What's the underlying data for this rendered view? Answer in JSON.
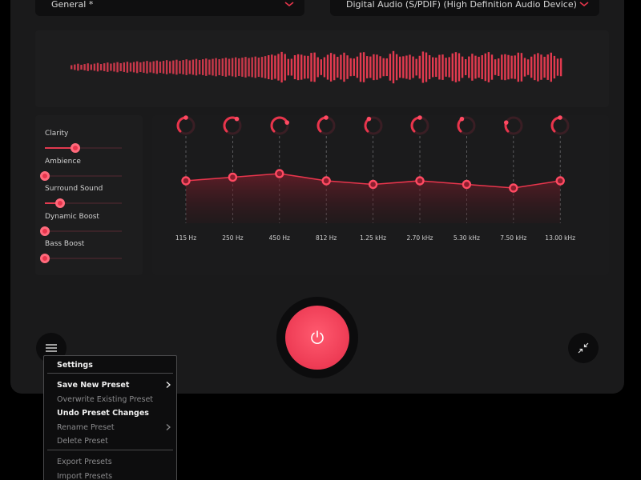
{
  "header": {
    "preset_dropdown": {
      "value": "General *"
    },
    "device_dropdown": {
      "value": "Digital Audio (S/PDIF) (High Definition Audio Device)"
    }
  },
  "effects": [
    {
      "label": "Clarity",
      "level": 0.4
    },
    {
      "label": "Ambience",
      "level": 0.0
    },
    {
      "label": "Surround Sound",
      "level": 0.2
    },
    {
      "label": "Dynamic Boost",
      "level": 0.0
    },
    {
      "label": "Bass Boost",
      "level": 0.0
    }
  ],
  "equalizer": {
    "bands": [
      {
        "label": "115 Hz",
        "gain": 0.0
      },
      {
        "label": "250 Hz",
        "gain": 0.5
      },
      {
        "label": "450 Hz",
        "gain": 1.0
      },
      {
        "label": "812 Hz",
        "gain": 0.0
      },
      {
        "label": "1.25 kHz",
        "gain": -0.5
      },
      {
        "label": "2.70 kHz",
        "gain": 0.0
      },
      {
        "label": "5.30 kHz",
        "gain": -0.5
      },
      {
        "label": "7.50 kHz",
        "gain": -1.0
      },
      {
        "label": "13.00 kHz",
        "gain": 0.0
      }
    ]
  },
  "menu": {
    "items": [
      {
        "label": "Settings",
        "enabled": true,
        "submenu": false
      },
      {
        "label": "Save New Preset",
        "enabled": true,
        "submenu": true
      },
      {
        "label": "Overwrite Existing Preset",
        "enabled": false,
        "submenu": false
      },
      {
        "label": "Undo Preset Changes",
        "enabled": true,
        "submenu": false
      },
      {
        "label": "Rename Preset",
        "enabled": false,
        "submenu": true
      },
      {
        "label": "Delete Preset",
        "enabled": false,
        "submenu": false
      },
      {
        "label": "Export Presets",
        "enabled": false,
        "submenu": false
      },
      {
        "label": "Import Presets",
        "enabled": false,
        "submenu": false
      }
    ]
  },
  "colors": {
    "accent": "#e8354c",
    "panel": "#1a1a1b",
    "background": "#000000"
  },
  "icons": {
    "power": "power-icon",
    "menu": "hamburger-icon",
    "minimize": "collapse-arrows-icon",
    "dropdown": "chevron-down-icon",
    "submenu": "chevron-right-icon"
  }
}
